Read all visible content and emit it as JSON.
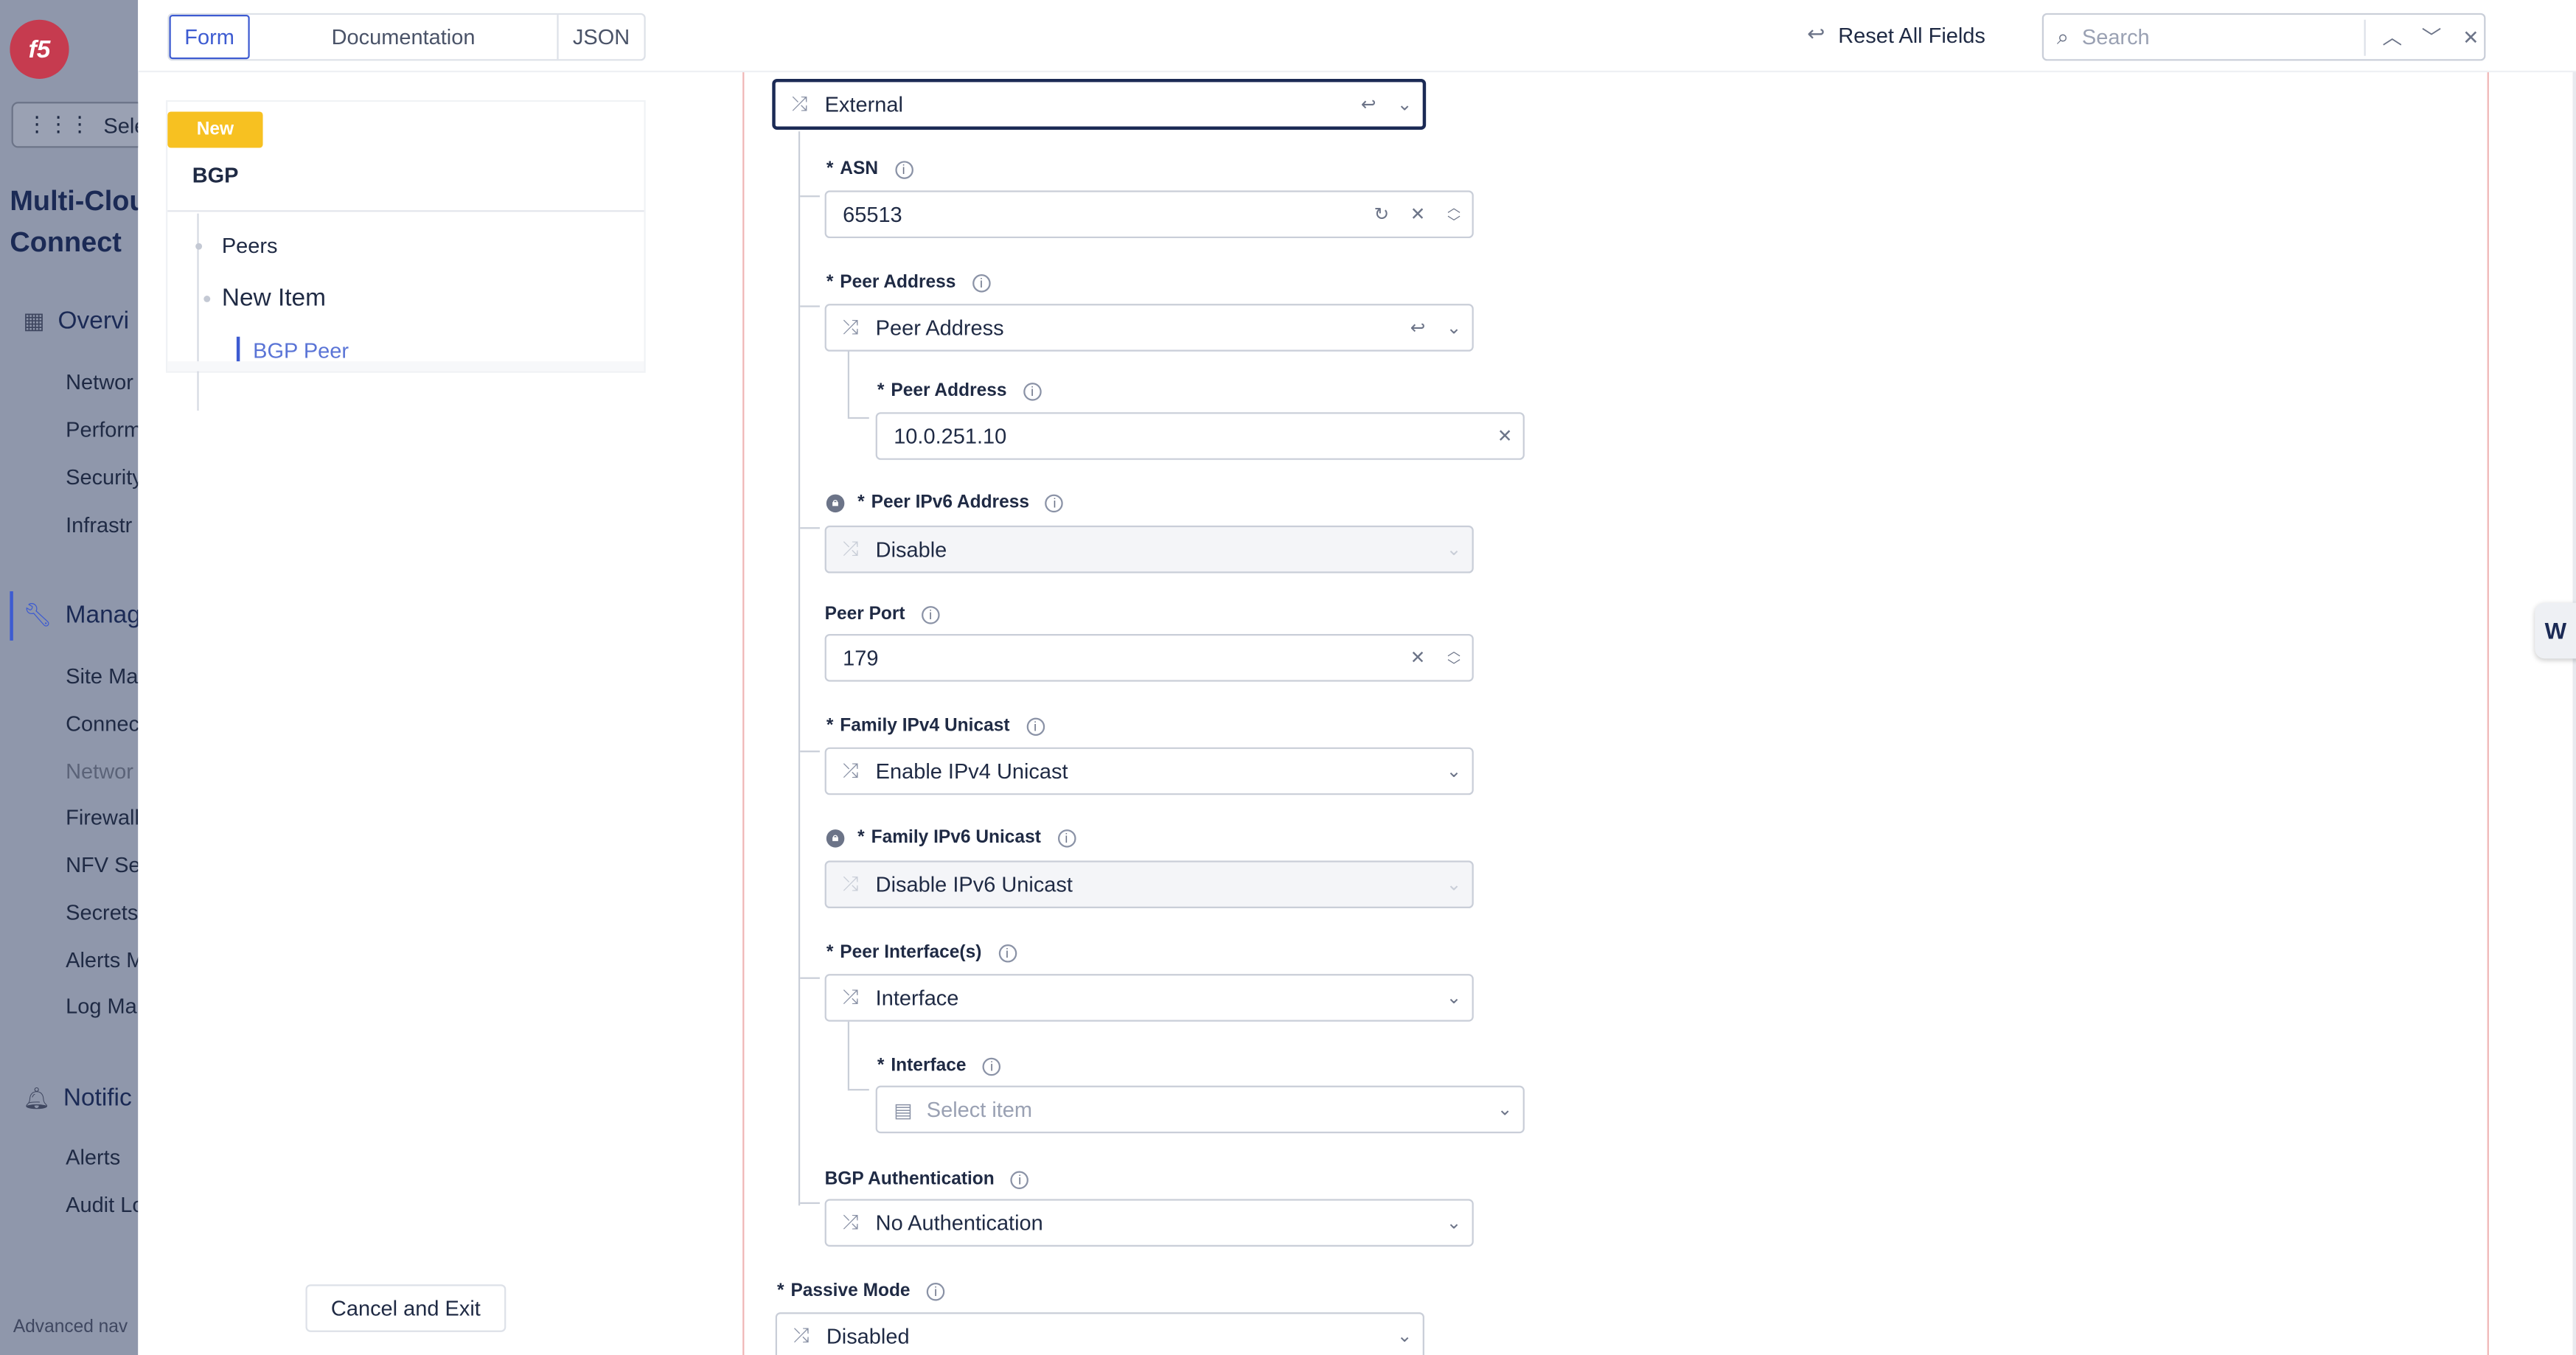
{
  "nav": {
    "workspace_label": "Select W",
    "app_title_line1": "Multi-Clou",
    "app_title_line2": "Connect",
    "sections": [
      {
        "label": "Overvi",
        "items": [
          "Networ",
          "Perform",
          "Security",
          "Infrastr"
        ]
      },
      {
        "label": "Manag",
        "items": [
          "Site Ma",
          "Connec",
          "Networ",
          "Firewall",
          "NFV Se",
          "Secrets",
          "Alerts M",
          "Log Ma"
        ]
      },
      {
        "label": "Notific",
        "items": [
          "Alerts",
          "Audit Lo"
        ]
      }
    ],
    "advanced_nav": "Advanced nav"
  },
  "tabs": [
    "Form",
    "Documentation",
    "JSON"
  ],
  "toolbar": {
    "reset_label": "Reset All Fields",
    "search_placeholder": "Search"
  },
  "tree": {
    "badge": "New",
    "root": "BGP",
    "node_peers": "Peers",
    "node_new_item": "New Item",
    "node_bgp_peer": "BGP Peer"
  },
  "cancel_label": "Cancel and Exit",
  "form": {
    "type_select": "External",
    "asn": {
      "label": "ASN",
      "value": "65513"
    },
    "peer_address": {
      "label": "Peer Address",
      "value": "Peer Address"
    },
    "peer_address_inner": {
      "label": "Peer Address",
      "value": "10.0.251.10"
    },
    "peer_ipv6": {
      "label": "Peer IPv6 Address",
      "value": "Disable"
    },
    "peer_port": {
      "label": "Peer Port",
      "value": "179"
    },
    "family_ipv4": {
      "label": "Family IPv4 Unicast",
      "value": "Enable IPv4 Unicast"
    },
    "family_ipv6": {
      "label": "Family IPv6 Unicast",
      "value": "Disable IPv6 Unicast"
    },
    "peer_interfaces": {
      "label": "Peer Interface(s)",
      "value": "Interface"
    },
    "interface": {
      "label": "Interface",
      "placeholder": "Select item"
    },
    "bgp_auth": {
      "label": "BGP Authentication",
      "value": "No Authentication"
    },
    "passive_mode": {
      "label": "Passive Mode",
      "value": "Disabled"
    }
  },
  "colors": {
    "accent": "#3d5bd1",
    "badge": "#f7c121",
    "brand": "#c63b4f"
  }
}
